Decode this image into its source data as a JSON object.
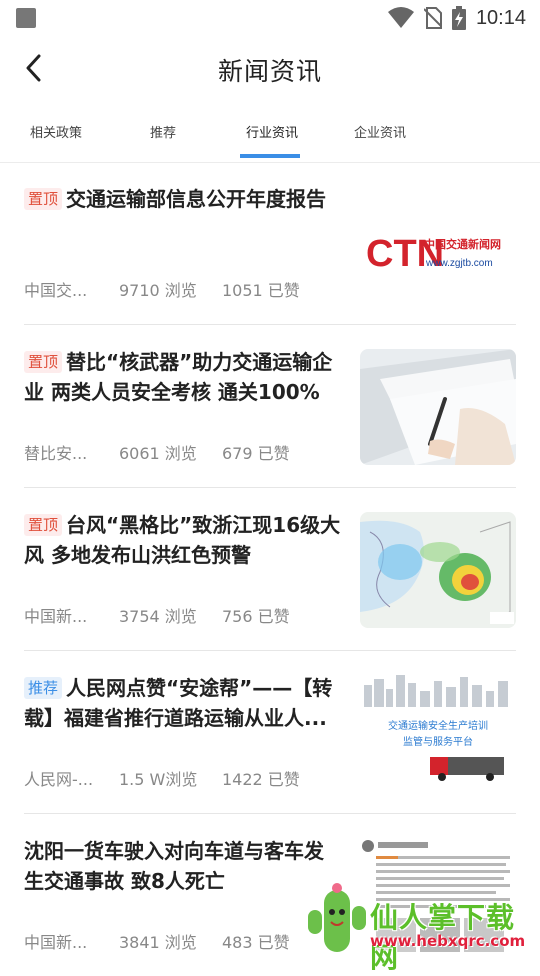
{
  "status_bar": {
    "time": "10:14"
  },
  "header": {
    "title": "新闻资讯"
  },
  "tabs": [
    {
      "label": "相关政策"
    },
    {
      "label": "推荐"
    },
    {
      "label": "行业资讯",
      "active": true
    },
    {
      "label": "企业资讯"
    }
  ],
  "news": [
    {
      "badge": "置顶",
      "badge_type": "top",
      "title": "交通运输部信息公开年度报告",
      "source": "中国交...",
      "views": "9710 浏览",
      "likes": "1051 已赞",
      "thumb_icon": "ctn-logo",
      "thumb_logo_text": "CTN",
      "thumb_logo_sub": "中国交通新闻网",
      "thumb_logo_url": "www.zgjtb.com"
    },
    {
      "badge": "置顶",
      "badge_type": "top",
      "title": "替比“核武器”助力交通运输企业 两类人员安全考核 通关100%",
      "source": "替比安...",
      "views": "6061 浏览",
      "likes": "679 已赞",
      "thumb_icon": "writing-exam-photo"
    },
    {
      "badge": "置顶",
      "badge_type": "top",
      "title": "台风“黑格比”致浙江现16级大风 多地发布山洪红色预警",
      "source": "中国新...",
      "views": "3754 浏览",
      "likes": "756 已赞",
      "thumb_icon": "typhoon-radar-map"
    },
    {
      "badge": "推荐",
      "badge_type": "rec",
      "title": "人民网点赞“安途帮”——【转载】福建省推行道路运输从业人...",
      "source": "人民网-...",
      "views": "1.5 W浏览",
      "likes": "1422 已赞",
      "thumb_icon": "transport-training-banner",
      "thumb_caption_1": "交通运输安全生产培训",
      "thumb_caption_2": "监管与服务平台"
    },
    {
      "badge": "",
      "badge_type": "",
      "title": "沈阳一货车驶入对向车道与客车发生交通事故 致8人死亡",
      "source": "中国新...",
      "views": "3841 浏览",
      "likes": "483 已赞",
      "thumb_icon": "weibo-post-screenshot"
    }
  ],
  "watermark": {
    "text": "仙人掌下载网",
    "url": "www.hebxqrc.com"
  },
  "colors": {
    "accent": "#3a8ee6",
    "top_badge": "#e0503c",
    "rec_badge": "#3a8ee6"
  }
}
